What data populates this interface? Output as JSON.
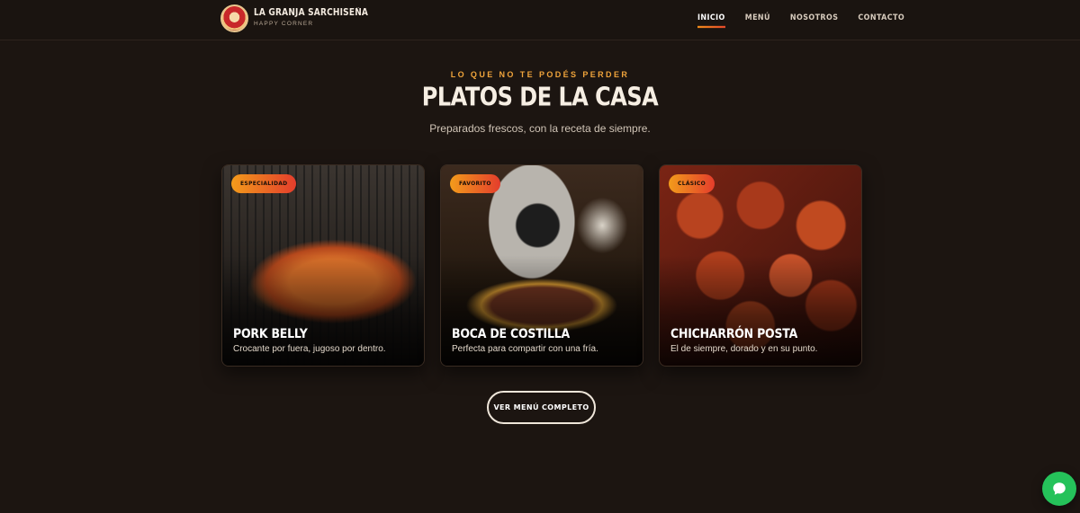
{
  "brand": {
    "name": "LA GRANJA SARCHISEÑA",
    "tagline": "HAPPY CORNER"
  },
  "nav": {
    "items": [
      {
        "label": "INICIO",
        "active": true
      },
      {
        "label": "MENÚ",
        "active": false
      },
      {
        "label": "NOSOTROS",
        "active": false
      },
      {
        "label": "CONTACTO",
        "active": false
      }
    ]
  },
  "section": {
    "eyebrow": "LO QUE NO TE PODÉS PERDER",
    "title": "PLATOS DE LA CASA",
    "subtitle": "Preparados frescos, con la receta de siempre."
  },
  "cards": [
    {
      "badge": "ESPECIALIDAD",
      "title": "PORK BELLY",
      "description": "Crocante por fuera, jugoso por dentro."
    },
    {
      "badge": "FAVORITO",
      "title": "BOCA DE COSTILLA",
      "description": "Perfecta para compartir con una fría."
    },
    {
      "badge": "CLÁSICO",
      "title": "CHICHARRÓN POSTA",
      "description": "El de siempre, dorado y en su punto."
    }
  ],
  "cta": {
    "label": "VER MENÚ COMPLETO"
  },
  "chat": {
    "icon": "chat-bubble-icon"
  },
  "colors": {
    "accent": "#f0a43b",
    "badge_start": "#f29b1b",
    "badge_end": "#e43d2c",
    "background": "#1c1511",
    "chat": "#25c25a"
  }
}
